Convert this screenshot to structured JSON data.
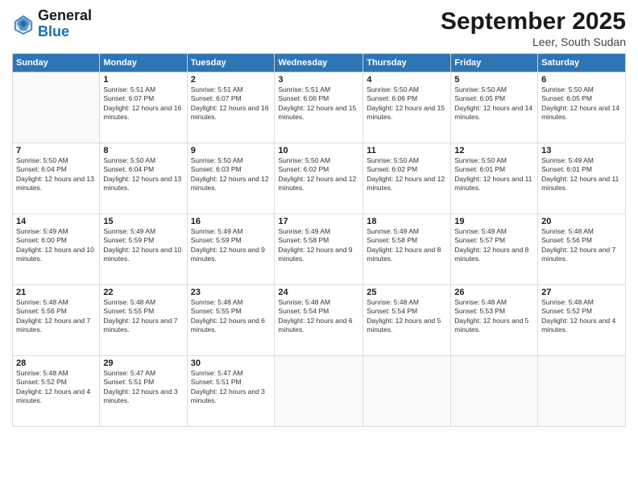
{
  "header": {
    "logo": {
      "general": "General",
      "blue": "Blue"
    },
    "title": "September 2025",
    "location": "Leer, South Sudan"
  },
  "weekdays": [
    "Sunday",
    "Monday",
    "Tuesday",
    "Wednesday",
    "Thursday",
    "Friday",
    "Saturday"
  ],
  "weeks": [
    [
      {
        "day": "",
        "sunrise": "",
        "sunset": "",
        "daylight": "",
        "empty": true
      },
      {
        "day": "1",
        "sunrise": "Sunrise: 5:51 AM",
        "sunset": "Sunset: 6:07 PM",
        "daylight": "Daylight: 12 hours and 16 minutes."
      },
      {
        "day": "2",
        "sunrise": "Sunrise: 5:51 AM",
        "sunset": "Sunset: 6:07 PM",
        "daylight": "Daylight: 12 hours and 16 minutes."
      },
      {
        "day": "3",
        "sunrise": "Sunrise: 5:51 AM",
        "sunset": "Sunset: 6:06 PM",
        "daylight": "Daylight: 12 hours and 15 minutes."
      },
      {
        "day": "4",
        "sunrise": "Sunrise: 5:50 AM",
        "sunset": "Sunset: 6:06 PM",
        "daylight": "Daylight: 12 hours and 15 minutes."
      },
      {
        "day": "5",
        "sunrise": "Sunrise: 5:50 AM",
        "sunset": "Sunset: 6:05 PM",
        "daylight": "Daylight: 12 hours and 14 minutes."
      },
      {
        "day": "6",
        "sunrise": "Sunrise: 5:50 AM",
        "sunset": "Sunset: 6:05 PM",
        "daylight": "Daylight: 12 hours and 14 minutes."
      }
    ],
    [
      {
        "day": "7",
        "sunrise": "Sunrise: 5:50 AM",
        "sunset": "Sunset: 6:04 PM",
        "daylight": "Daylight: 12 hours and 13 minutes."
      },
      {
        "day": "8",
        "sunrise": "Sunrise: 5:50 AM",
        "sunset": "Sunset: 6:04 PM",
        "daylight": "Daylight: 12 hours and 13 minutes."
      },
      {
        "day": "9",
        "sunrise": "Sunrise: 5:50 AM",
        "sunset": "Sunset: 6:03 PM",
        "daylight": "Daylight: 12 hours and 12 minutes."
      },
      {
        "day": "10",
        "sunrise": "Sunrise: 5:50 AM",
        "sunset": "Sunset: 6:02 PM",
        "daylight": "Daylight: 12 hours and 12 minutes."
      },
      {
        "day": "11",
        "sunrise": "Sunrise: 5:50 AM",
        "sunset": "Sunset: 6:02 PM",
        "daylight": "Daylight: 12 hours and 12 minutes."
      },
      {
        "day": "12",
        "sunrise": "Sunrise: 5:50 AM",
        "sunset": "Sunset: 6:01 PM",
        "daylight": "Daylight: 12 hours and 11 minutes."
      },
      {
        "day": "13",
        "sunrise": "Sunrise: 5:49 AM",
        "sunset": "Sunset: 6:01 PM",
        "daylight": "Daylight: 12 hours and 11 minutes."
      }
    ],
    [
      {
        "day": "14",
        "sunrise": "Sunrise: 5:49 AM",
        "sunset": "Sunset: 6:00 PM",
        "daylight": "Daylight: 12 hours and 10 minutes."
      },
      {
        "day": "15",
        "sunrise": "Sunrise: 5:49 AM",
        "sunset": "Sunset: 5:59 PM",
        "daylight": "Daylight: 12 hours and 10 minutes."
      },
      {
        "day": "16",
        "sunrise": "Sunrise: 5:49 AM",
        "sunset": "Sunset: 5:59 PM",
        "daylight": "Daylight: 12 hours and 9 minutes."
      },
      {
        "day": "17",
        "sunrise": "Sunrise: 5:49 AM",
        "sunset": "Sunset: 5:58 PM",
        "daylight": "Daylight: 12 hours and 9 minutes."
      },
      {
        "day": "18",
        "sunrise": "Sunrise: 5:49 AM",
        "sunset": "Sunset: 5:58 PM",
        "daylight": "Daylight: 12 hours and 8 minutes."
      },
      {
        "day": "19",
        "sunrise": "Sunrise: 5:49 AM",
        "sunset": "Sunset: 5:57 PM",
        "daylight": "Daylight: 12 hours and 8 minutes."
      },
      {
        "day": "20",
        "sunrise": "Sunrise: 5:48 AM",
        "sunset": "Sunset: 5:56 PM",
        "daylight": "Daylight: 12 hours and 7 minutes."
      }
    ],
    [
      {
        "day": "21",
        "sunrise": "Sunrise: 5:48 AM",
        "sunset": "Sunset: 5:56 PM",
        "daylight": "Daylight: 12 hours and 7 minutes."
      },
      {
        "day": "22",
        "sunrise": "Sunrise: 5:48 AM",
        "sunset": "Sunset: 5:55 PM",
        "daylight": "Daylight: 12 hours and 7 minutes."
      },
      {
        "day": "23",
        "sunrise": "Sunrise: 5:48 AM",
        "sunset": "Sunset: 5:55 PM",
        "daylight": "Daylight: 12 hours and 6 minutes."
      },
      {
        "day": "24",
        "sunrise": "Sunrise: 5:48 AM",
        "sunset": "Sunset: 5:54 PM",
        "daylight": "Daylight: 12 hours and 6 minutes."
      },
      {
        "day": "25",
        "sunrise": "Sunrise: 5:48 AM",
        "sunset": "Sunset: 5:54 PM",
        "daylight": "Daylight: 12 hours and 5 minutes."
      },
      {
        "day": "26",
        "sunrise": "Sunrise: 5:48 AM",
        "sunset": "Sunset: 5:53 PM",
        "daylight": "Daylight: 12 hours and 5 minutes."
      },
      {
        "day": "27",
        "sunrise": "Sunrise: 5:48 AM",
        "sunset": "Sunset: 5:52 PM",
        "daylight": "Daylight: 12 hours and 4 minutes."
      }
    ],
    [
      {
        "day": "28",
        "sunrise": "Sunrise: 5:48 AM",
        "sunset": "Sunset: 5:52 PM",
        "daylight": "Daylight: 12 hours and 4 minutes."
      },
      {
        "day": "29",
        "sunrise": "Sunrise: 5:47 AM",
        "sunset": "Sunset: 5:51 PM",
        "daylight": "Daylight: 12 hours and 3 minutes."
      },
      {
        "day": "30",
        "sunrise": "Sunrise: 5:47 AM",
        "sunset": "Sunset: 5:51 PM",
        "daylight": "Daylight: 12 hours and 3 minutes."
      },
      {
        "day": "",
        "sunrise": "",
        "sunset": "",
        "daylight": "",
        "empty": true
      },
      {
        "day": "",
        "sunrise": "",
        "sunset": "",
        "daylight": "",
        "empty": true
      },
      {
        "day": "",
        "sunrise": "",
        "sunset": "",
        "daylight": "",
        "empty": true
      },
      {
        "day": "",
        "sunrise": "",
        "sunset": "",
        "daylight": "",
        "empty": true
      }
    ]
  ]
}
